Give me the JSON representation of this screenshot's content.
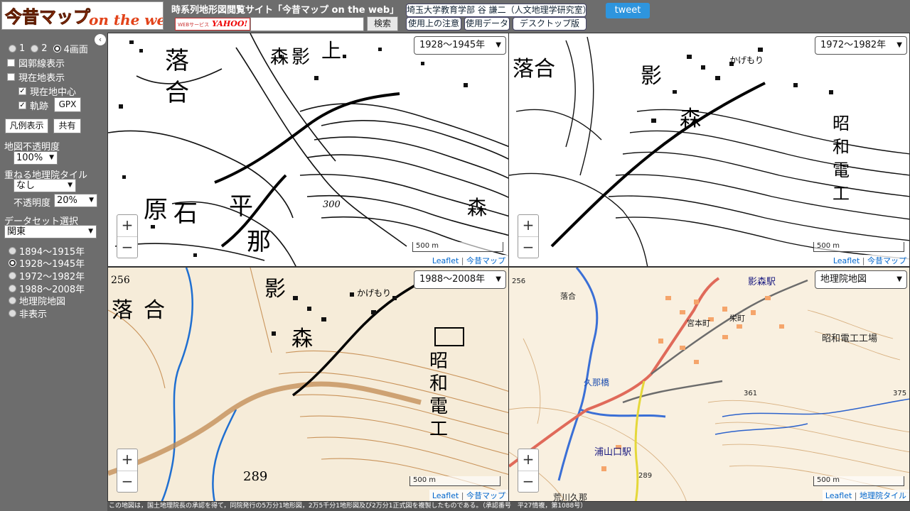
{
  "header": {
    "logo_text": "今昔マップ on the web",
    "site_title": "時系列地形図閲覧サイト「今昔マップ on the web」",
    "yahoo_badge": "WEBサービス",
    "yahoo_name": "YAHOO!",
    "search_button": "検索",
    "author": "埼玉大学教育学部 谷 謙二（人文地理学研究室）",
    "usage_notes": "使用上の注意",
    "data_used": "使用データ",
    "desktop": "デスクトップ版",
    "tweet": "tweet"
  },
  "sidebar": {
    "collapse_icon": "‹",
    "layout_options": [
      "1",
      "2",
      "4画面"
    ],
    "layout_selected": "4画面",
    "show_grid": "図郭線表示",
    "show_current": "現在地表示",
    "center_current": "現在地中心",
    "track": "軌跡",
    "gpx": "GPX",
    "legend": "凡例表示",
    "share": "共有",
    "opacity_label": "地図不透明度",
    "opacity_value": "100%",
    "overlay_label": "重ねる地理院タイル",
    "overlay_value": "なし",
    "overlay_opacity_label": "不透明度",
    "overlay_opacity_value": "20%",
    "dataset_label": "データセット選択",
    "dataset_value": "関東",
    "eras": [
      "1894～1915年",
      "1928～1945年",
      "1972～1982年",
      "1988～2008年",
      "地理院地図",
      "非表示"
    ],
    "era_selected": "1928～1945年"
  },
  "panels": [
    {
      "era": "1928～1945年",
      "scale": "500 m",
      "attrib": [
        "Leaflet",
        "今昔マップ"
      ]
    },
    {
      "era": "1972～1982年",
      "scale": "500 m",
      "attrib": [
        "Leaflet",
        "今昔マップ"
      ]
    },
    {
      "era": "1988～2008年",
      "scale": "500 m",
      "attrib": [
        "Leaflet",
        "今昔マップ"
      ]
    },
    {
      "era": "地理院地図",
      "scale": "500 m",
      "attrib": [
        "Leaflet",
        "地理院タイル"
      ]
    }
  ],
  "map_labels": {
    "p1": [
      "落",
      "合",
      "森",
      "影",
      "上",
      "原",
      "石",
      "平",
      "那",
      "森"
    ],
    "p1_num": "300",
    "p2": [
      "落合",
      "影",
      "森",
      "昭",
      "和",
      "電",
      "工",
      "かげもり"
    ],
    "p3": [
      "落",
      "合",
      "影",
      "森",
      "昭",
      "和",
      "電",
      "工",
      "かげもり",
      "256",
      "289"
    ],
    "p4": [
      "影森駅",
      "宮本町",
      "栄町",
      "昭和電工工場",
      "久那橋",
      "浦山口駅",
      "荒川久那",
      "落合",
      "361",
      "375",
      "256",
      "289"
    ]
  },
  "zoom": {
    "plus": "+",
    "minus": "−"
  },
  "footer_note": "この地図は，国土地理院長の承認を得て，同院発行の5万分1地形図，2万5千分1地形図及び2万分1正式図を複製したものである。（承認番号　平27情複，第1088号）",
  "colors": {
    "bg": "#6d6d6d",
    "tweet": "#2e95de",
    "road": "#d9534f",
    "river": "#2a6fd6"
  }
}
